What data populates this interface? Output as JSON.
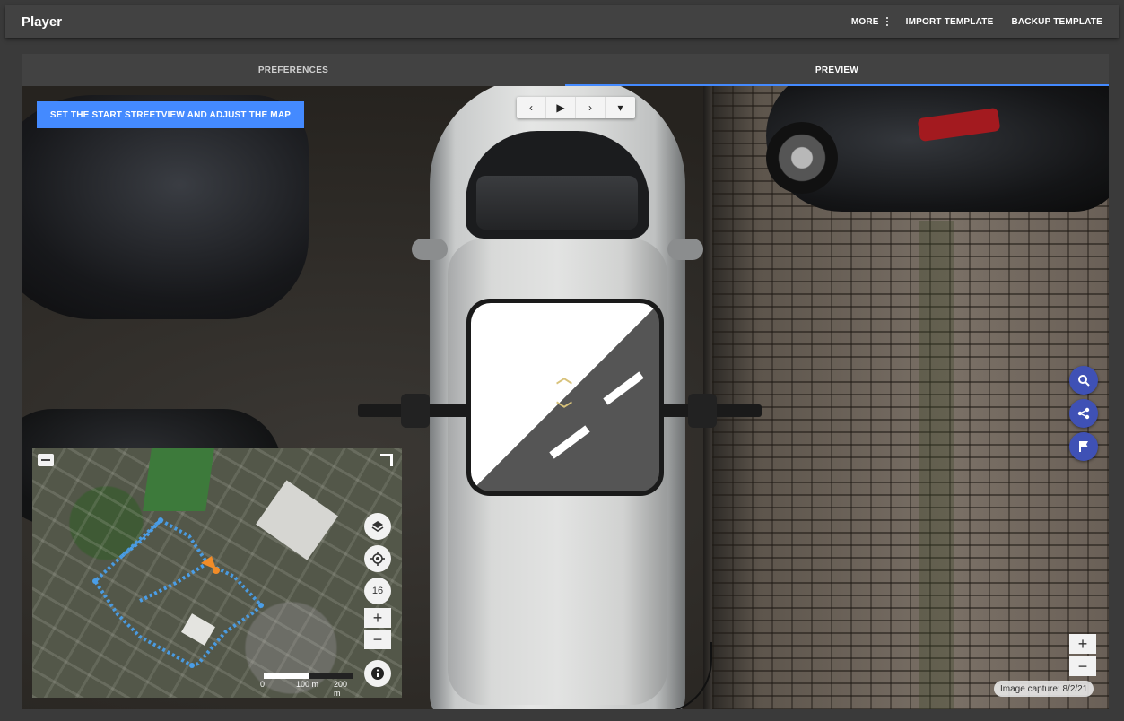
{
  "app": {
    "title": "Player"
  },
  "toolbar": {
    "more_label": "MORE",
    "import_label": "IMPORT TEMPLATE",
    "backup_label": "BACKUP TEMPLATE"
  },
  "tabs": [
    {
      "label": "PREFERENCES",
      "active": false
    },
    {
      "label": "PREVIEW",
      "active": true
    }
  ],
  "streetview": {
    "start_button_label": "SET THE START STREETVIEW AND ADJUST THE MAP",
    "player_controls": [
      {
        "icon": "chevron-left-icon",
        "glyph": "‹"
      },
      {
        "icon": "play-icon",
        "glyph": "▶"
      },
      {
        "icon": "chevron-right-icon",
        "glyph": "›"
      },
      {
        "icon": "dropdown-icon",
        "glyph": "▾"
      }
    ],
    "zoom_in": "+",
    "zoom_out": "−",
    "capture_text": "Image capture: 8/2/21",
    "accent_color": "#448aff",
    "fab_color": "#3f51b5"
  },
  "minimap": {
    "zoom_level": "16",
    "zoom_in": "+",
    "zoom_out": "−",
    "scale": {
      "start": "0",
      "mid": "100 m",
      "end": "200 m"
    },
    "route_color": "#4a9ee8",
    "position_color": "#f28c28"
  }
}
